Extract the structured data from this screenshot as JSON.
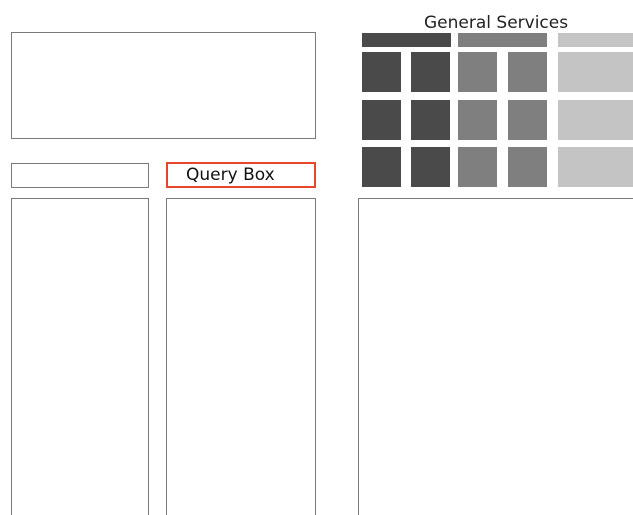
{
  "query_box": {
    "label": "Query Box"
  },
  "services": {
    "title": "General Services"
  },
  "colors": {
    "query_border": "#e8462b",
    "panel_border": "#7a7a7a",
    "tile_dark": "#4a4a4a",
    "tile_mid": "#7f7f7f",
    "tile_light": "#c4c4c4"
  }
}
